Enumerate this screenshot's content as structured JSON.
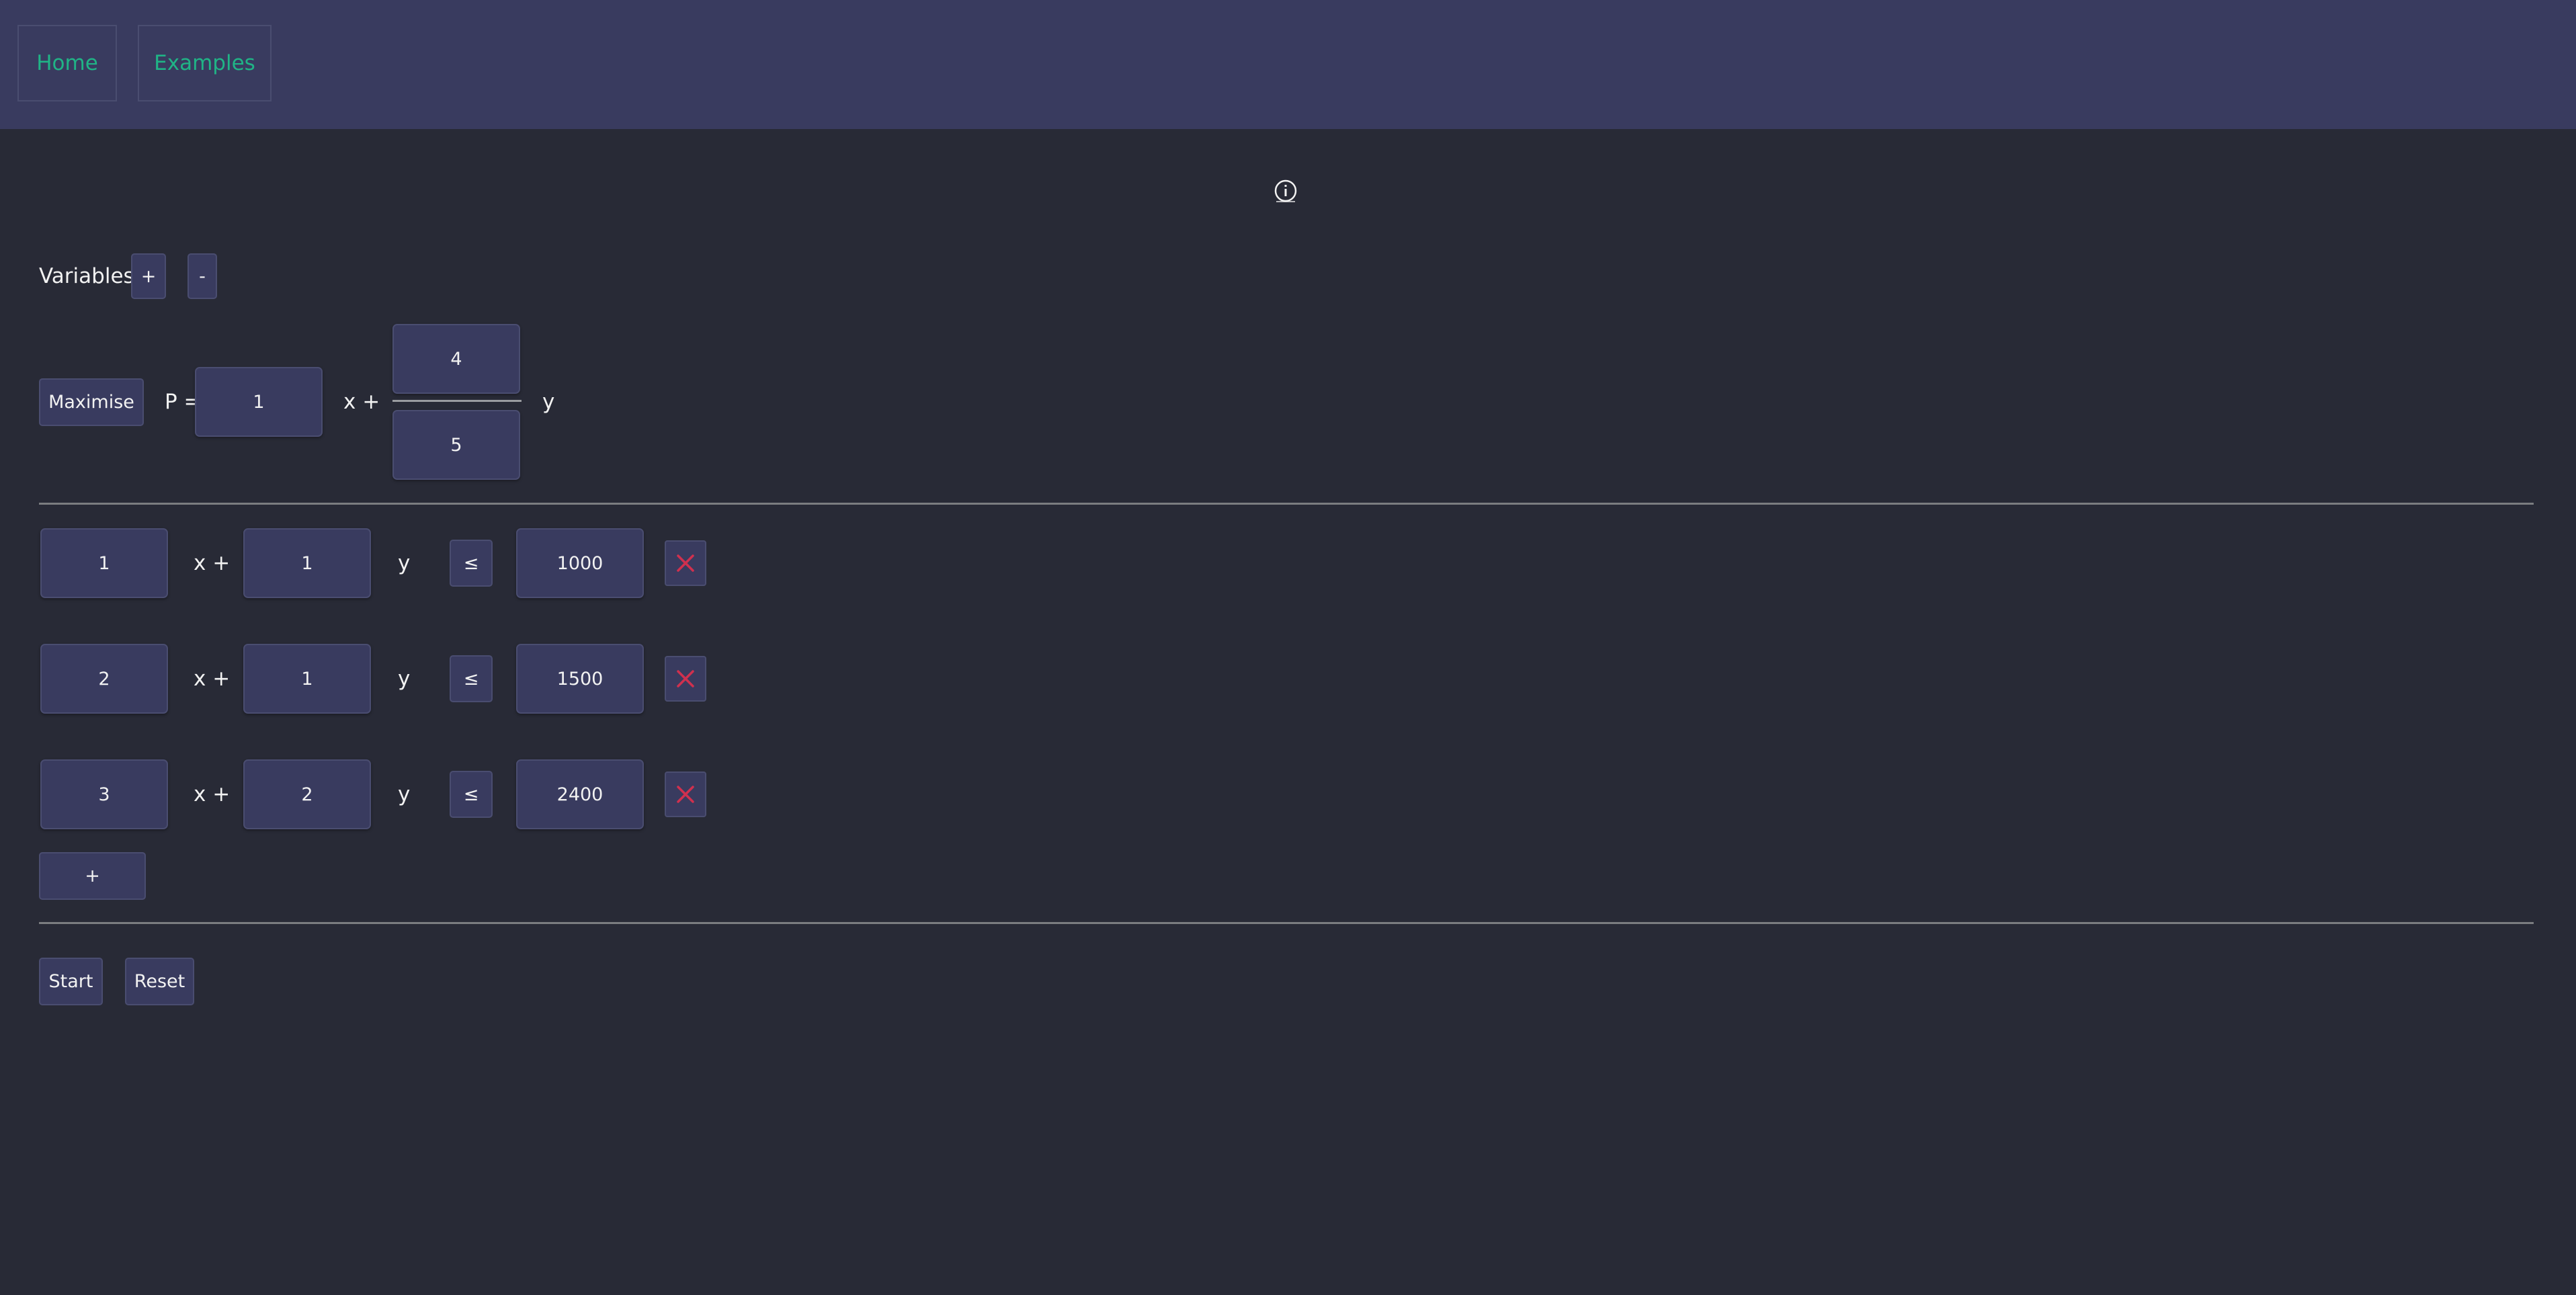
{
  "nav": {
    "home": "Home",
    "examples": "Examples"
  },
  "variables": {
    "label": "Variables:",
    "add": "+",
    "remove": "-"
  },
  "objective": {
    "mode": "Maximise",
    "prefix": "P =",
    "x_coef": "1",
    "x_suffix": "x +",
    "y_numerator": "4",
    "y_denominator": "5",
    "y_suffix": "y"
  },
  "constraints": [
    {
      "x_coef": "1",
      "x_suffix": "x +",
      "y_coef": "1",
      "y_suffix": "y",
      "relation": "≤",
      "rhs": "1000"
    },
    {
      "x_coef": "2",
      "x_suffix": "x +",
      "y_coef": "1",
      "y_suffix": "y",
      "relation": "≤",
      "rhs": "1500"
    },
    {
      "x_coef": "3",
      "x_suffix": "x +",
      "y_coef": "2",
      "y_suffix": "y",
      "relation": "≤",
      "rhs": "2400"
    }
  ],
  "add_constraint": "+",
  "actions": {
    "start": "Start",
    "reset": "Reset"
  },
  "colors": {
    "background": "#282a36",
    "navbar": "#393b5f",
    "nav_link": "#20b486",
    "delete": "#d0304e"
  },
  "icons": {
    "info": "info-circle-icon",
    "delete": "close-x-icon"
  }
}
